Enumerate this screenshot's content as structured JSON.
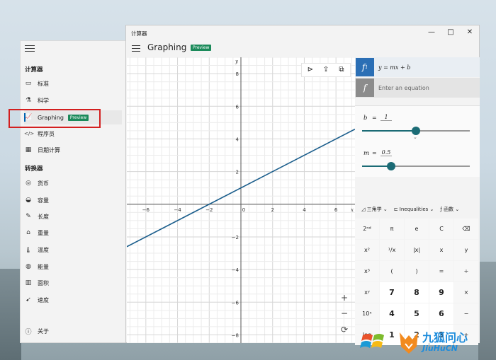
{
  "nav": {
    "section_calc": "计算器",
    "section_conv": "转换器",
    "items": [
      {
        "icon": "▭",
        "label": "标准"
      },
      {
        "icon": "⚗",
        "label": "科学"
      },
      {
        "icon": "📈",
        "label": "Graphing",
        "badge": "Preview"
      },
      {
        "icon": "</>",
        "label": "程序员"
      },
      {
        "icon": "▦",
        "label": "日期计算"
      }
    ],
    "converters": [
      {
        "icon": "◎",
        "label": "货币"
      },
      {
        "icon": "◒",
        "label": "容量"
      },
      {
        "icon": "✎",
        "label": "长度"
      },
      {
        "icon": "⌂",
        "label": "重量"
      },
      {
        "icon": "🌡",
        "label": "温度"
      },
      {
        "icon": "◍",
        "label": "能量"
      },
      {
        "icon": "▥",
        "label": "面积"
      },
      {
        "icon": "➹",
        "label": "速度"
      }
    ],
    "about": "关于"
  },
  "window": {
    "title": "计算器",
    "header": "Graphing",
    "badge": "Preview",
    "controls": [
      "—",
      "□",
      "✕"
    ]
  },
  "graph": {
    "x_axis_label": "x",
    "y_axis_label": "y",
    "x_ticks": [
      "−6",
      "−4",
      "−2",
      "0",
      "2",
      "4",
      "6"
    ],
    "y_ticks": [
      "8",
      "6",
      "4",
      "2",
      "−2",
      "−4",
      "−6",
      "−8"
    ],
    "x_range": [
      -7.2,
      7.2
    ],
    "y_range": [
      -8.5,
      9
    ],
    "line": {
      "m": 0.5,
      "b": 1,
      "color": "#1b5e8c"
    },
    "tools": [
      "⊳",
      "⇪",
      "⧉"
    ],
    "zoom": [
      "+",
      "−",
      "⟳"
    ]
  },
  "equations": [
    {
      "icon": "f",
      "sub": "1",
      "text": "y = mx + b",
      "color": "#2b6fb5"
    },
    {
      "icon": "f",
      "placeholder": "Enter an equation",
      "color": "#8c8c8c"
    }
  ],
  "variables": [
    {
      "name": "b",
      "value": "1",
      "fraction": 0.5
    },
    {
      "name": "m",
      "value": "0.5",
      "fraction": 0.27
    }
  ],
  "keyboard_bar": [
    "◿ 三角学 ⌄",
    "⊏ Inequalities ⌄",
    "ƒ 函数 ⌄"
  ],
  "keys": [
    [
      "2ⁿᵈ",
      "π",
      "e",
      "C",
      "⌫"
    ],
    [
      "x²",
      "¹/x",
      "|x|",
      "x",
      "y"
    ],
    [
      "x³",
      "(",
      ")",
      "=",
      "÷"
    ],
    [
      "xʸ",
      "7",
      "8",
      "9",
      "×"
    ],
    [
      "10ˣ",
      "4",
      "5",
      "6",
      "−"
    ],
    [
      "log",
      "1",
      "2",
      "3",
      "+"
    ]
  ],
  "watermark": {
    "cn": "九狐问心",
    "en": "JiuHuCN"
  }
}
